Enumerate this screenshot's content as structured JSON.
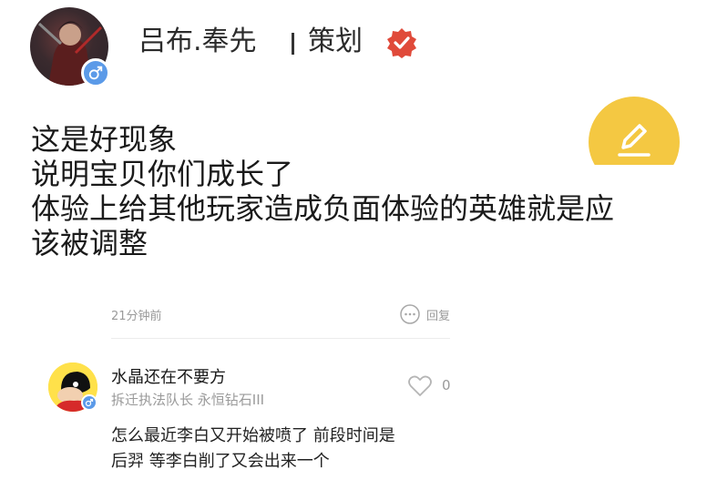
{
  "post": {
    "author": {
      "name": "吕布.奉先",
      "role": "策划"
    },
    "lines": [
      "这是好现象",
      "说明宝贝你们成长了",
      "体验上给其他玩家造成负面体验的英雄就是应",
      "该被调整"
    ],
    "time": "21分钟前",
    "reply_label": "回复"
  },
  "comment": {
    "name": "水晶还在不要方",
    "title": "拆迁执法队长 永恒钻石III",
    "likes": "0",
    "text_line1": "怎么最近李白又开始被喷了 前段时间是",
    "text_line2": "后羿 等李白削了又会出来一个"
  },
  "colors": {
    "accent": "#f4c842",
    "verified": "#e04a3a",
    "gender_blue": "#5b9ae8",
    "muted_text": "#9a9a9a"
  },
  "icons": [
    "male-icon",
    "verified-icon",
    "edit-icon",
    "reply-bubble-icon",
    "heart-icon"
  ]
}
